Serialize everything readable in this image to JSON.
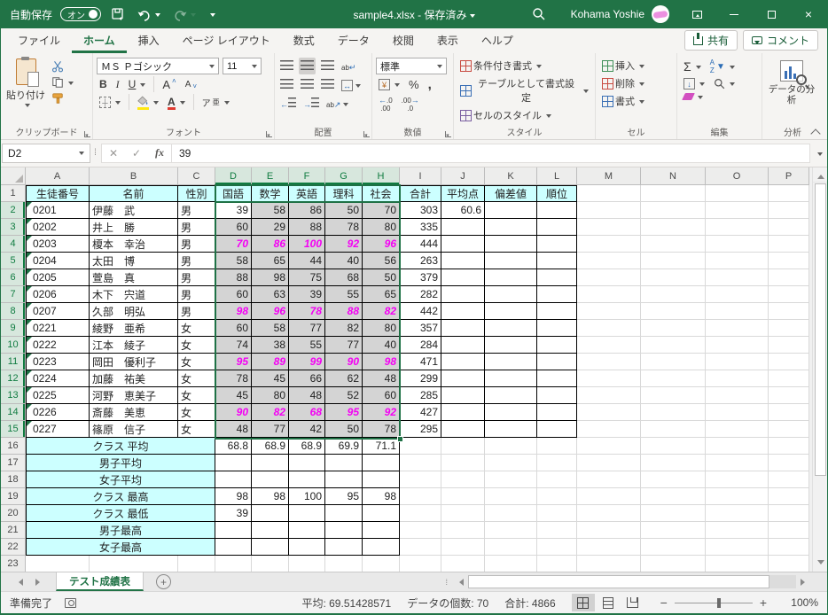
{
  "titlebar": {
    "autosave_label": "自動保存",
    "autosave_state": "オン",
    "doc_title": "sample4.xlsx - 保存済み",
    "user_name": "Kohama Yoshie"
  },
  "ribbon_tabs": [
    {
      "label": "ファイル"
    },
    {
      "label": "ホーム",
      "active": true
    },
    {
      "label": "挿入"
    },
    {
      "label": "ページ レイアウト"
    },
    {
      "label": "数式"
    },
    {
      "label": "データ"
    },
    {
      "label": "校閲"
    },
    {
      "label": "表示"
    },
    {
      "label": "ヘルプ"
    }
  ],
  "share": {
    "share_label": "共有",
    "comments_label": "コメント"
  },
  "ribbon": {
    "paste_label": "貼り付け",
    "font_name": "ＭＳ Ｐゴシック",
    "font_size": "11",
    "number_format": "標準",
    "styles": {
      "conditional": "条件付き書式",
      "format_table": "テーブルとして書式設定",
      "cell_styles": "セルのスタイル"
    },
    "cells": {
      "insert": "挿入",
      "delete": "削除",
      "format": "書式"
    },
    "analysis_label": "データの分析",
    "furigana_glyph": "ア",
    "group_labels": {
      "clipboard": "クリップボード",
      "font": "フォント",
      "alignment": "配置",
      "number": "数値",
      "styles": "スタイル",
      "cells": "セル",
      "editing": "編集",
      "analysis": "分析"
    }
  },
  "formula_bar": {
    "cell_ref": "D2",
    "value": "39"
  },
  "grid": {
    "columns": [
      "A",
      "B",
      "C",
      "D",
      "E",
      "F",
      "G",
      "H",
      "I",
      "J",
      "K",
      "L",
      "M",
      "N",
      "O",
      "P"
    ],
    "selected_columns": [
      "D",
      "E",
      "F",
      "G",
      "H"
    ],
    "selection": {
      "range": "D2:H15",
      "active_cell": "D2",
      "row_from": 2,
      "row_to": 15
    },
    "header_labels": [
      "生徒番号",
      "名前",
      "性別",
      "国語",
      "数学",
      "英語",
      "理科",
      "社会",
      "合計",
      "平均点",
      "偏差値",
      "順位"
    ],
    "students": [
      {
        "id": "0201",
        "name": "伊藤　武",
        "gender": "男",
        "scores": [
          39,
          58,
          86,
          50,
          70
        ],
        "total": 303,
        "average": "60.6",
        "highlight": false
      },
      {
        "id": "0202",
        "name": "井上　勝",
        "gender": "男",
        "scores": [
          60,
          29,
          88,
          78,
          80
        ],
        "total": 335,
        "average": "",
        "highlight": false
      },
      {
        "id": "0203",
        "name": "榎本　幸治",
        "gender": "男",
        "scores": [
          70,
          86,
          100,
          92,
          96
        ],
        "total": 444,
        "average": "",
        "highlight": true
      },
      {
        "id": "0204",
        "name": "太田　博",
        "gender": "男",
        "scores": [
          58,
          65,
          44,
          40,
          56
        ],
        "total": 263,
        "average": "",
        "highlight": false
      },
      {
        "id": "0205",
        "name": "萱島　真",
        "gender": "男",
        "scores": [
          88,
          98,
          75,
          68,
          50
        ],
        "total": 379,
        "average": "",
        "highlight": false
      },
      {
        "id": "0206",
        "name": "木下　宍道",
        "gender": "男",
        "scores": [
          60,
          63,
          39,
          55,
          65
        ],
        "total": 282,
        "average": "",
        "highlight": false
      },
      {
        "id": "0207",
        "name": "久部　明弘",
        "gender": "男",
        "scores": [
          98,
          96,
          78,
          88,
          82
        ],
        "total": 442,
        "average": "",
        "highlight": true
      },
      {
        "id": "0221",
        "name": "綾野　亜希",
        "gender": "女",
        "scores": [
          60,
          58,
          77,
          82,
          80
        ],
        "total": 357,
        "average": "",
        "highlight": false
      },
      {
        "id": "0222",
        "name": "江本　綾子",
        "gender": "女",
        "scores": [
          74,
          38,
          55,
          77,
          40
        ],
        "total": 284,
        "average": "",
        "highlight": false
      },
      {
        "id": "0223",
        "name": "岡田　優利子",
        "gender": "女",
        "scores": [
          95,
          89,
          99,
          90,
          98
        ],
        "total": 471,
        "average": "",
        "highlight": true
      },
      {
        "id": "0224",
        "name": "加藤　祐美",
        "gender": "女",
        "scores": [
          78,
          45,
          66,
          62,
          48
        ],
        "total": 299,
        "average": "",
        "highlight": false
      },
      {
        "id": "0225",
        "name": "河野　恵美子",
        "gender": "女",
        "scores": [
          45,
          80,
          48,
          52,
          60
        ],
        "total": 285,
        "average": "",
        "highlight": false
      },
      {
        "id": "0226",
        "name": "斎藤　美恵",
        "gender": "女",
        "scores": [
          90,
          82,
          68,
          95,
          92
        ],
        "total": 427,
        "average": "",
        "highlight": true
      },
      {
        "id": "0227",
        "name": "篠原　信子",
        "gender": "女",
        "scores": [
          48,
          77,
          42,
          50,
          78
        ],
        "total": 295,
        "average": "",
        "highlight": false
      }
    ],
    "summary": [
      {
        "label": "クラス 平均",
        "values": [
          "68.8",
          "68.9",
          "68.9",
          "69.9",
          "71.1"
        ]
      },
      {
        "label": "男子平均",
        "values": [
          "",
          "",
          "",
          "",
          ""
        ]
      },
      {
        "label": "女子平均",
        "values": [
          "",
          "",
          "",
          "",
          ""
        ]
      },
      {
        "label": "クラス 最高",
        "values": [
          "98",
          "98",
          "100",
          "95",
          "98"
        ]
      },
      {
        "label": "クラス 最低",
        "values": [
          "39",
          "",
          "",
          "",
          ""
        ]
      },
      {
        "label": "男子最高",
        "values": [
          "",
          "",
          "",
          "",
          ""
        ]
      },
      {
        "label": "女子最高",
        "values": [
          "",
          "",
          "",
          "",
          ""
        ]
      }
    ]
  },
  "sheet_tabs": {
    "active": "テスト成績表"
  },
  "status_bar": {
    "ready": "準備完了",
    "average": "平均: 69.51428571",
    "count": "データの個数: 70",
    "sum": "合計: 4866",
    "zoom": "100%"
  },
  "icons": {
    "autosave-toggle": "pill-switch-on",
    "save": "save-with-sync-arrows",
    "undo": "arrow-counterclockwise",
    "redo": "arrow-clockwise",
    "search": "magnifier",
    "window-minimize": "minus-bar",
    "window-maximize": "square",
    "window-close": "x",
    "paste": "clipboard",
    "cut": "scissors",
    "copy": "two-pages",
    "format-painter": "brush",
    "fill-color": "bucket-yellow-bar",
    "font-color": "A-red-bar",
    "autosum": "sigma",
    "sort-filter": "az-funnel",
    "find": "magnifier",
    "clear": "pink-eraser",
    "analyze-data": "chart-with-magnifier",
    "new-sheet": "plus-circle",
    "cell-error-flag": "green-corner-triangle"
  }
}
